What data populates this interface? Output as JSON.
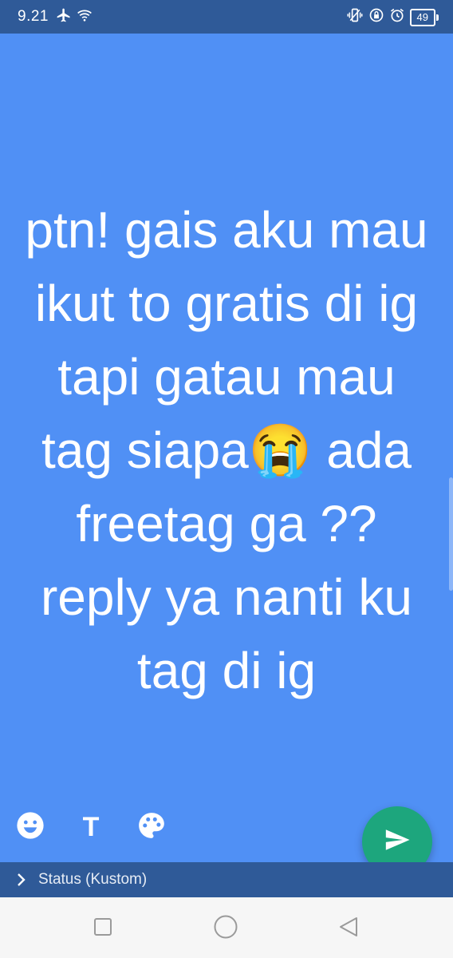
{
  "status_bar": {
    "time": "9.21",
    "battery_level": "49",
    "icons": [
      "airplane-icon",
      "wifi-icon",
      "vibrate-icon",
      "rotation-lock-icon",
      "alarm-icon",
      "battery-icon"
    ]
  },
  "editor": {
    "background_color": "#5090f5",
    "text_before_emoji": "ptn! gais aku mau ikut to gratis di ig tapi gatau mau tag siapa",
    "emoji": "😭",
    "text_after_emoji": " ada freetag ga ?? reply ya nanti ku tag di ig"
  },
  "toolbar": {
    "items": [
      "emoji-icon",
      "text-style-icon",
      "palette-icon"
    ],
    "text_style_label": "T"
  },
  "send_button": {
    "color": "#1da67d",
    "icon": "send-icon"
  },
  "caption_bar": {
    "label": "Status (Kustom)"
  },
  "nav_bar": {
    "items": [
      "recents-icon",
      "home-icon",
      "back-icon"
    ]
  }
}
